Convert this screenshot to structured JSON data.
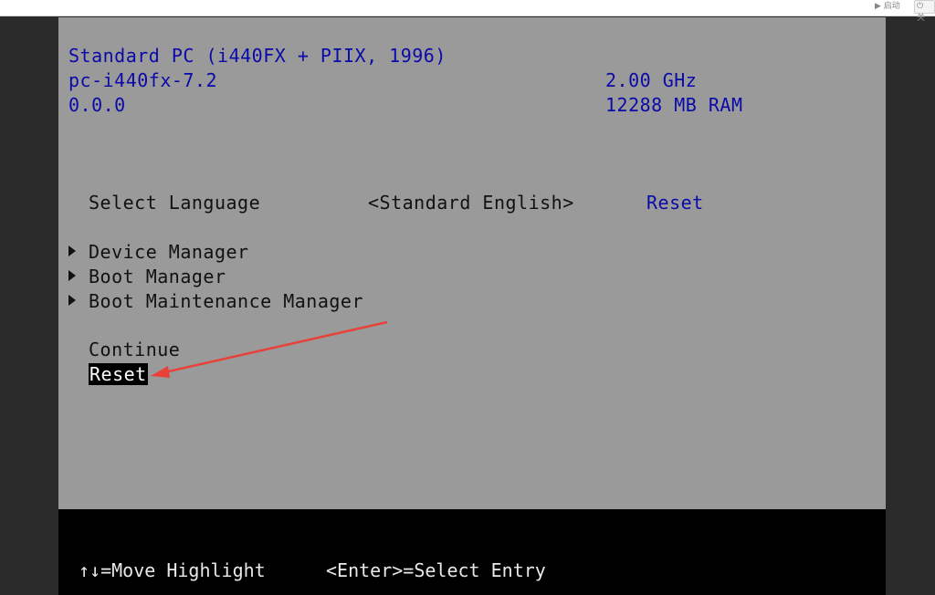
{
  "window": {
    "start_label": "▶ 启动",
    "power_label": "⏻ 关"
  },
  "bios": {
    "platform": "Standard PC (i440FX + PIIX, 1996)",
    "machine": "pc-i440fx-7.2",
    "version": "0.0.0",
    "cpu_speed": "2.00 GHz",
    "ram": "12288 MB RAM",
    "language_label": "Select Language",
    "language_value": "<Standard English>",
    "language_reset": "Reset",
    "menu": [
      {
        "label": "Device Manager"
      },
      {
        "label": "Boot Manager"
      },
      {
        "label": "Boot Maintenance Manager"
      }
    ],
    "continue_label": "Continue",
    "reset_label": "Reset",
    "footer_move": "↑↓=Move Highlight",
    "footer_select": "<Enter>=Select Entry"
  },
  "colors": {
    "screen_bg": "#9a9a9a",
    "text_blue": "#0a0aa8",
    "annotation": "#e8413a"
  }
}
